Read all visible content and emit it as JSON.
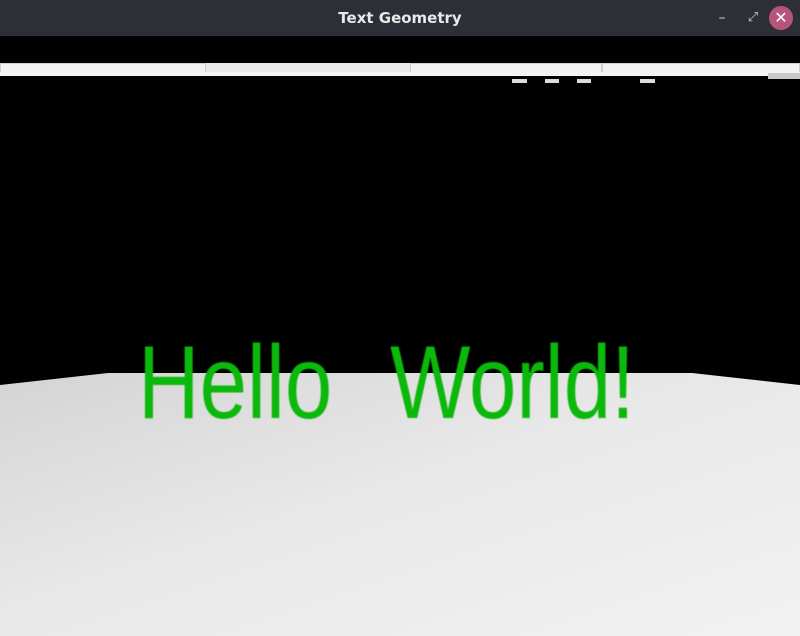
{
  "window": {
    "title": "Text Geometry",
    "controls": {
      "minimize_icon": "minimize-icon",
      "maximize_icon": "maximize-icon",
      "close_icon": "close-icon"
    },
    "accent": "#b6557a"
  },
  "scene": {
    "text_left": "Hello",
    "text_right": "World!",
    "text_color": "#0bb80b",
    "background_color": "#000000",
    "floor_color": "#e6e6e6"
  }
}
